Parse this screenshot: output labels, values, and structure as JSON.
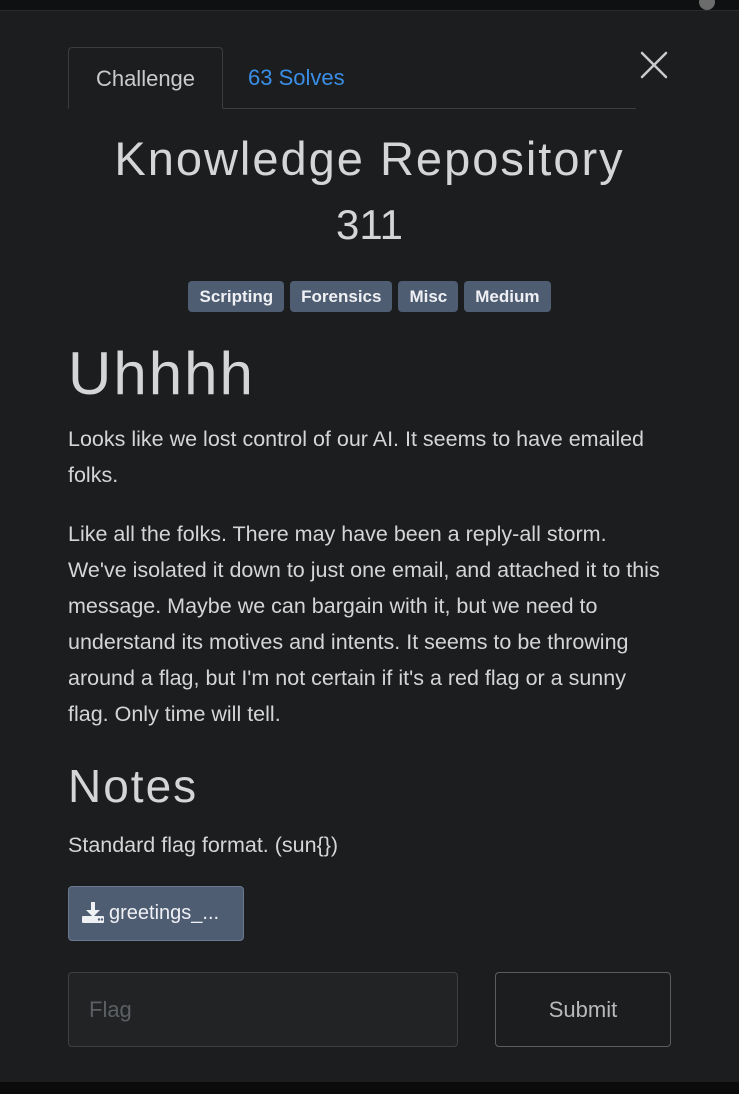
{
  "tabs": {
    "challenge_label": "Challenge",
    "solves_label": "63 Solves"
  },
  "challenge": {
    "title": "Knowledge Repository",
    "points": "311",
    "tags": [
      "Scripting",
      "Forensics",
      "Misc",
      "Medium"
    ],
    "description_heading": "Uhhhh",
    "paragraphs": [
      "Looks like we lost control of our AI. It seems to have emailed folks.",
      "Like all the folks. There may have been a reply-all storm. We've isolated it down to just one email, and attached it to this message. Maybe we can bargain with it, but we need to understand its motives and intents. It seems to be throwing around a flag, but I'm not certain if it's a red flag or a sunny flag. Only time will tell."
    ],
    "notes_heading": "Notes",
    "notes_text": "Standard flag format. (sun{})"
  },
  "attachment": {
    "label": "greetings_...",
    "icon": "download-icon"
  },
  "form": {
    "flag_placeholder": "Flag",
    "flag_value": "",
    "submit_label": "Submit"
  },
  "icons": {
    "close": "close-icon"
  },
  "colors": {
    "background": "#1c1d1f",
    "accent_link": "#3a8ee6",
    "tag_bg": "#4f5d73",
    "text": "#d4d5d6"
  }
}
